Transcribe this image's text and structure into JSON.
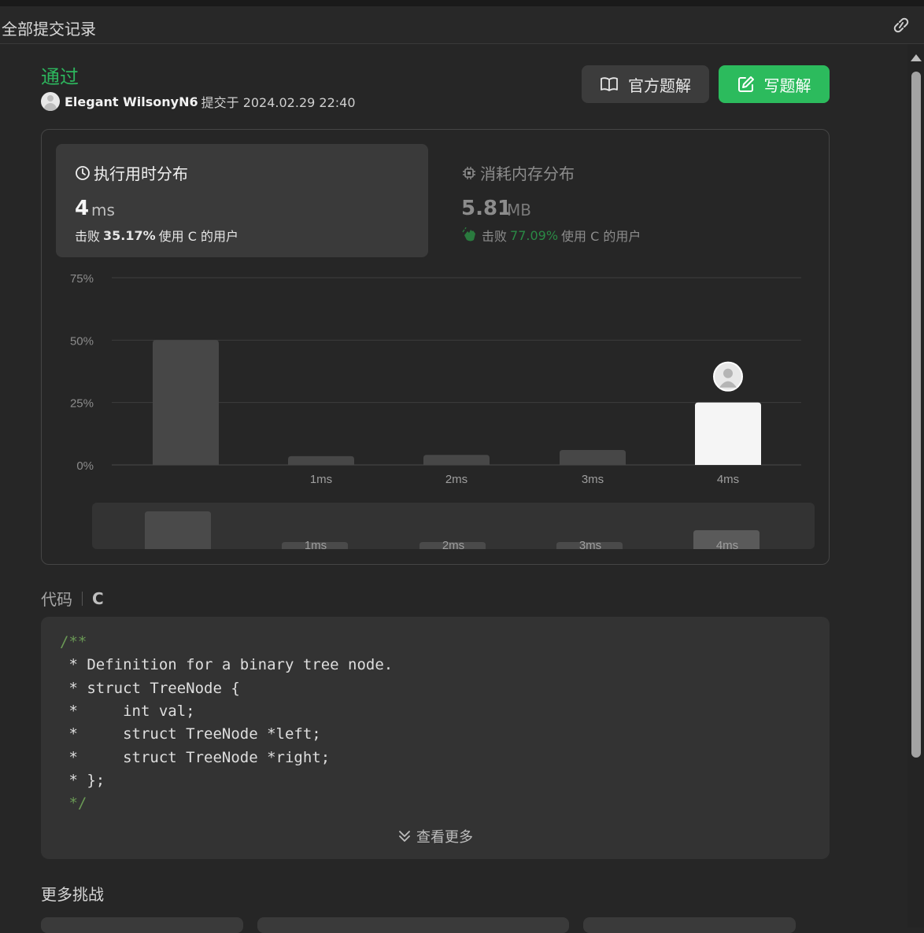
{
  "header": {
    "title": "全部提交记录",
    "link_icon": "link-icon"
  },
  "submission": {
    "status": "通过",
    "author": "Elegant WilsonyN6",
    "submitted_text": "提交于 2024.02.29 22:40"
  },
  "buttons": {
    "official": "官方题解",
    "write": "写题解"
  },
  "runtime": {
    "title": "执行用时分布",
    "value": "4",
    "unit": "ms",
    "beat_prefix": "击败",
    "beat_pct": "35.17%",
    "beat_suffix": "使用 C 的用户"
  },
  "memory": {
    "title": "消耗内存分布",
    "value": "5.81",
    "unit": "MB",
    "beat_prefix": "击败",
    "beat_pct": "77.09%",
    "beat_suffix": "使用 C 的用户"
  },
  "chart_data": {
    "type": "bar",
    "categories": [
      "",
      "1ms",
      "2ms",
      "3ms",
      "4ms"
    ],
    "values": [
      50,
      3.5,
      4,
      6,
      25
    ],
    "highlight_index": 4,
    "ylim": [
      0,
      75
    ],
    "yticks": [
      "0%",
      "25%",
      "50%",
      "75%"
    ],
    "grid": true,
    "overview_values": [
      50,
      3.5,
      4,
      6,
      25
    ]
  },
  "code": {
    "label": "代码",
    "language": "C",
    "lines": [
      {
        "text": "/**",
        "comment": true
      },
      {
        "text": " * Definition for a binary tree node.",
        "comment": false
      },
      {
        "text": " * struct TreeNode {",
        "comment": false
      },
      {
        "text": " *     int val;",
        "comment": false
      },
      {
        "text": " *     struct TreeNode *left;",
        "comment": false
      },
      {
        "text": " *     struct TreeNode *right;",
        "comment": false
      },
      {
        "text": " * };",
        "comment": false
      },
      {
        "text": " */",
        "comment": true
      }
    ],
    "more": "查看更多"
  },
  "more_challenges": {
    "title": "更多挑战"
  }
}
